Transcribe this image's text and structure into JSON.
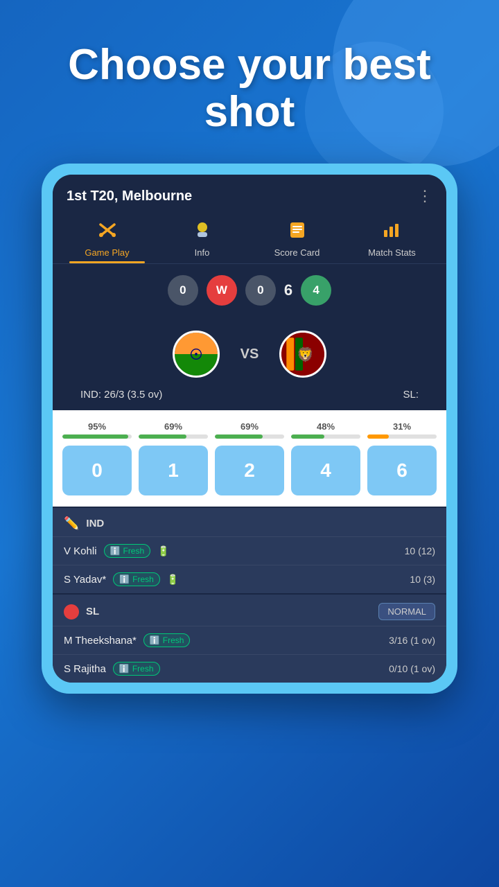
{
  "hero": {
    "title": "Choose your best shot"
  },
  "header": {
    "match_title": "1st T20, Melbourne",
    "more_icon": "⋮"
  },
  "nav_tabs": [
    {
      "id": "gameplay",
      "label": "Game Play",
      "icon": "🏏",
      "active": true
    },
    {
      "id": "info",
      "label": "Info",
      "icon": "🌤",
      "active": false
    },
    {
      "id": "scorecard",
      "label": "Score Card",
      "icon": "📋",
      "active": false
    },
    {
      "id": "matchstats",
      "label": "Match Stats",
      "icon": "📊",
      "active": false
    }
  ],
  "ball_row": [
    {
      "value": "0",
      "type": "grey"
    },
    {
      "value": "W",
      "type": "wicket"
    },
    {
      "value": "0",
      "type": "grey"
    },
    {
      "value": "6",
      "type": "number"
    },
    {
      "value": "4",
      "type": "green"
    }
  ],
  "teams": {
    "team1": {
      "name": "IND",
      "flag_emoji": "🇮🇳",
      "score": "IND: 26/3 (3.5 ov)"
    },
    "vs": "VS",
    "team2": {
      "name": "SL",
      "flag_emoji": "🇱🇰",
      "score": "SL:"
    }
  },
  "shot_options": [
    {
      "label": "0",
      "percentage": "95%",
      "bar_pct": 95,
      "bar_color": "green"
    },
    {
      "label": "1",
      "percentage": "69%",
      "bar_pct": 69,
      "bar_color": "green"
    },
    {
      "label": "2",
      "percentage": "69%",
      "bar_pct": 69,
      "bar_color": "green"
    },
    {
      "label": "4",
      "percentage": "48%",
      "bar_pct": 48,
      "bar_color": "green"
    },
    {
      "label": "6",
      "percentage": "31%",
      "bar_pct": 31,
      "bar_color": "orange"
    }
  ],
  "batting_section": {
    "team": "IND",
    "icon": "✏️",
    "players": [
      {
        "name": "V Kohli",
        "status": "Fresh",
        "score": "10 (12)"
      },
      {
        "name": "S Yadav*",
        "status": "Fresh",
        "score": "10 (3)"
      }
    ]
  },
  "bowling_section": {
    "team": "SL",
    "mode": "NORMAL",
    "players": [
      {
        "name": "M Theekshana*",
        "status": "Fresh",
        "score": "3/16 (1 ov)"
      },
      {
        "name": "S Rajitha",
        "status": "Fresh",
        "score": "0/10 (1 ov)"
      }
    ]
  }
}
